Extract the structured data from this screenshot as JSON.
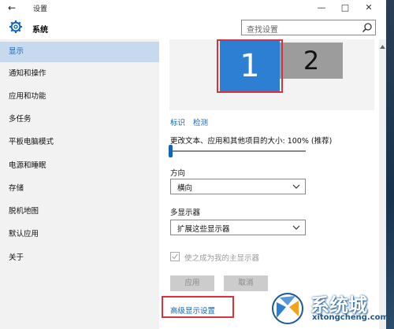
{
  "window": {
    "title": "设置"
  },
  "header": {
    "section_title": "系统",
    "search_placeholder": "查找设置"
  },
  "sidebar": {
    "items": [
      {
        "label": "显示",
        "active": true
      },
      {
        "label": "通知和操作"
      },
      {
        "label": "应用和功能"
      },
      {
        "label": "多任务"
      },
      {
        "label": "平板电脑模式"
      },
      {
        "label": "电源和睡眠"
      },
      {
        "label": "存储"
      },
      {
        "label": "脱机地图"
      },
      {
        "label": "默认应用"
      },
      {
        "label": "关于"
      }
    ]
  },
  "display": {
    "monitor_1": "1",
    "monitor_2": "2",
    "identify_link": "标识",
    "detect_link": "检测",
    "scale_label": "更改文本、应用和其他项目的大小: 100% (推荐)",
    "orientation_label": "方向",
    "orientation_value": "横向",
    "multi_display_label": "多显示器",
    "multi_display_value": "扩展这些显示器",
    "main_display_checkbox": "使之成为我的主显示器",
    "apply_button": "应用",
    "cancel_button": "取消",
    "advanced_link": "高级显示设置"
  },
  "watermark": {
    "brand": "系统城",
    "url": "xitongcheng.com"
  },
  "colors": {
    "accent": "#1464b4",
    "active_nav": "#c6d9ef",
    "monitor_selected": "#2d7fd4",
    "highlight_box": "#d6333e"
  }
}
